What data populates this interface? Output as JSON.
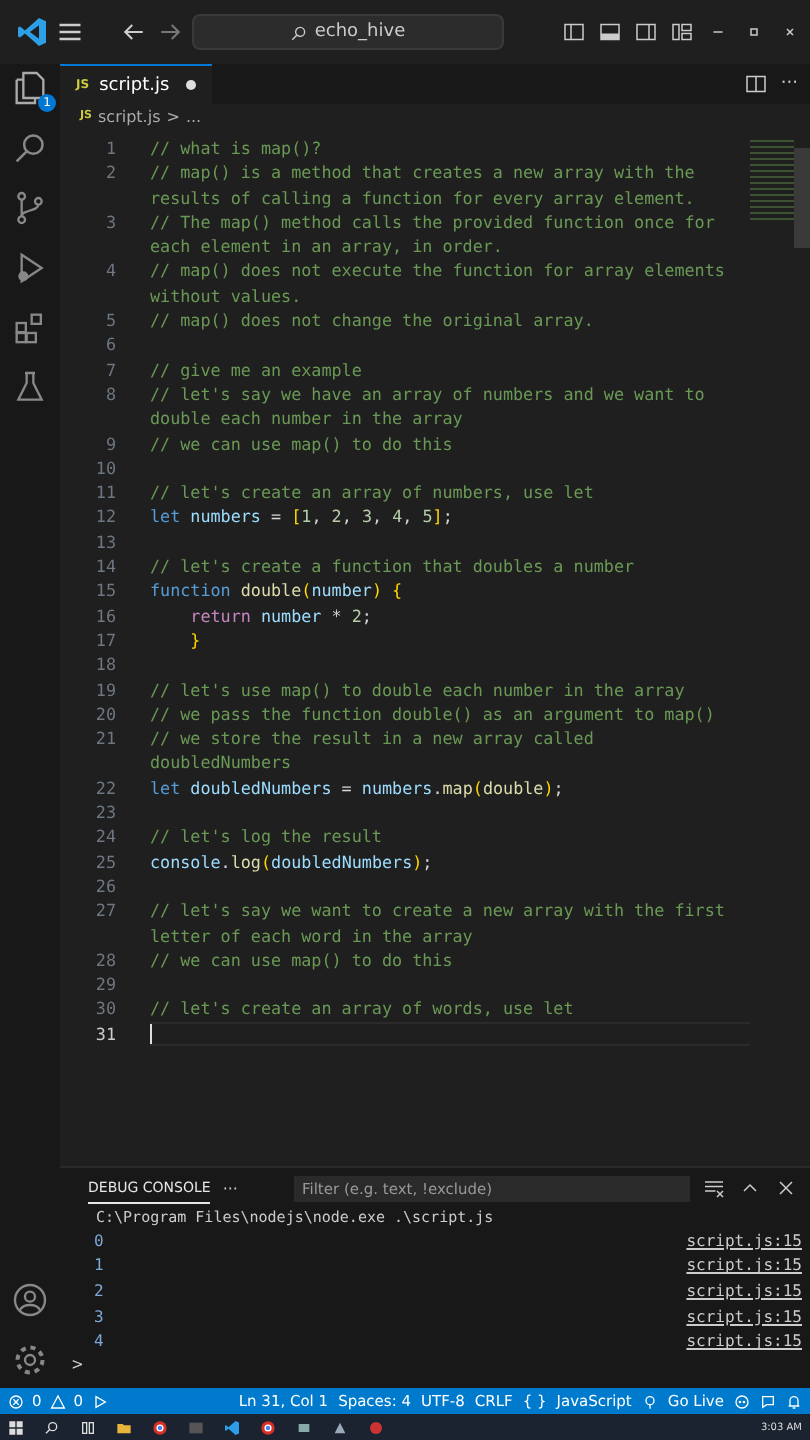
{
  "title_bar": {
    "search": "echo_hive"
  },
  "activity_bar": {
    "explorer_badge": "1"
  },
  "tabs": [
    {
      "label": "script.js",
      "file_icon": "JS",
      "modified": true,
      "selected": true
    }
  ],
  "editor_actions": {
    "more": "···"
  },
  "breadcrumb": {
    "file_icon": "JS",
    "file": "script.js",
    "separator": ">",
    "rest": "..."
  },
  "editor": {
    "lines": [
      {
        "number": "1",
        "current": false,
        "tokens": [
          {
            "kind": "comment",
            "text": "// what is map()?"
          }
        ]
      },
      {
        "number": "2",
        "current": false,
        "tokens": [
          {
            "kind": "comment",
            "text": "// map() is a method that creates a new array with the results of calling a function for every array element."
          }
        ]
      },
      {
        "number": "3",
        "current": false,
        "tokens": [
          {
            "kind": "comment",
            "text": "// The map() method calls the provided function once for each element in an array, in order."
          }
        ]
      },
      {
        "number": "4",
        "current": false,
        "tokens": [
          {
            "kind": "comment",
            "text": "// map() does not execute the function for array elements without values."
          }
        ]
      },
      {
        "number": "5",
        "current": false,
        "tokens": [
          {
            "kind": "comment",
            "text": "// map() does not change the original array."
          }
        ]
      },
      {
        "number": "6",
        "current": false
      },
      {
        "number": "7",
        "current": false,
        "tokens": [
          {
            "kind": "comment",
            "text": "// give me an example"
          }
        ]
      },
      {
        "number": "8",
        "current": false,
        "tokens": [
          {
            "kind": "comment",
            "text": "// let's say we have an array of numbers and we want to double each number in the array"
          }
        ]
      },
      {
        "number": "9",
        "current": false,
        "tokens": [
          {
            "kind": "comment",
            "text": "// we can use map() to do this"
          }
        ]
      },
      {
        "number": "10",
        "current": false
      },
      {
        "number": "11",
        "current": false,
        "tokens": [
          {
            "kind": "comment",
            "text": "// let's create an array of numbers, use let"
          }
        ]
      },
      {
        "number": "12",
        "current": false,
        "tokens": [
          {
            "kind": "keyword",
            "text": "let "
          },
          {
            "kind": "variable",
            "text": "numbers"
          },
          {
            "kind": "plain",
            "text": " = "
          },
          {
            "kind": "bracket",
            "text": "["
          },
          {
            "kind": "number",
            "text": "1"
          },
          {
            "kind": "plain",
            "text": ", "
          },
          {
            "kind": "number",
            "text": "2"
          },
          {
            "kind": "plain",
            "text": ", "
          },
          {
            "kind": "number",
            "text": "3"
          },
          {
            "kind": "plain",
            "text": ", "
          },
          {
            "kind": "number",
            "text": "4"
          },
          {
            "kind": "plain",
            "text": ", "
          },
          {
            "kind": "number",
            "text": "5"
          },
          {
            "kind": "bracket",
            "text": "]"
          },
          {
            "kind": "plain",
            "text": ";"
          }
        ]
      },
      {
        "number": "13",
        "current": false
      },
      {
        "number": "14",
        "current": false,
        "tokens": [
          {
            "kind": "comment",
            "text": "// let's create a function that doubles a number"
          }
        ]
      },
      {
        "number": "15",
        "current": false,
        "tokens": [
          {
            "kind": "keyword",
            "text": "function "
          },
          {
            "kind": "function",
            "text": "double"
          },
          {
            "kind": "bracket",
            "text": "("
          },
          {
            "kind": "variable",
            "text": "number"
          },
          {
            "kind": "bracket",
            "text": ") {"
          }
        ]
      },
      {
        "number": "16",
        "current": false,
        "tokens": [
          {
            "kind": "control",
            "text": "    return "
          },
          {
            "kind": "variable",
            "text": "number"
          },
          {
            "kind": "plain",
            "text": " * "
          },
          {
            "kind": "number",
            "text": "2"
          },
          {
            "kind": "plain",
            "text": ";"
          }
        ]
      },
      {
        "number": "17",
        "current": false,
        "tokens": [
          {
            "kind": "bracket",
            "text": "    }"
          }
        ]
      },
      {
        "number": "18",
        "current": false
      },
      {
        "number": "19",
        "current": false,
        "tokens": [
          {
            "kind": "comment",
            "text": "// let's use map() to double each number in the array"
          }
        ]
      },
      {
        "number": "20",
        "current": false,
        "tokens": [
          {
            "kind": "comment",
            "text": "// we pass the function double() as an argument to map()"
          }
        ]
      },
      {
        "number": "21",
        "current": false,
        "tokens": [
          {
            "kind": "comment",
            "text": "// we store the result in a new array called doubledNumbers"
          }
        ]
      },
      {
        "number": "22",
        "current": false,
        "tokens": [
          {
            "kind": "keyword",
            "text": "let "
          },
          {
            "kind": "variable",
            "text": "doubledNumbers"
          },
          {
            "kind": "plain",
            "text": " = "
          },
          {
            "kind": "variable",
            "text": "numbers"
          },
          {
            "kind": "plain",
            "text": "."
          },
          {
            "kind": "function",
            "text": "map"
          },
          {
            "kind": "bracket",
            "text": "("
          },
          {
            "kind": "function",
            "text": "double"
          },
          {
            "kind": "bracket",
            "text": ")"
          },
          {
            "kind": "plain",
            "text": ";"
          }
        ]
      },
      {
        "number": "23",
        "current": false
      },
      {
        "number": "24",
        "current": false,
        "tokens": [
          {
            "kind": "comment",
            "text": "// let's log the result"
          }
        ]
      },
      {
        "number": "25",
        "current": false,
        "tokens": [
          {
            "kind": "variable",
            "text": "console"
          },
          {
            "kind": "plain",
            "text": "."
          },
          {
            "kind": "function",
            "text": "log"
          },
          {
            "kind": "bracket",
            "text": "("
          },
          {
            "kind": "variable",
            "text": "doubledNumbers"
          },
          {
            "kind": "bracket",
            "text": ")"
          },
          {
            "kind": "plain",
            "text": ";"
          }
        ]
      },
      {
        "number": "26",
        "current": false
      },
      {
        "number": "27",
        "current": false,
        "tokens": [
          {
            "kind": "comment",
            "text": "// let's say we want to create a new array with the first letter of each word in the array"
          }
        ]
      },
      {
        "number": "28",
        "current": false,
        "tokens": [
          {
            "kind": "comment",
            "text": "// we can use map() to do this"
          }
        ]
      },
      {
        "number": "29",
        "current": false
      },
      {
        "number": "30",
        "current": false,
        "tokens": [
          {
            "kind": "comment",
            "text": "// let's create an array of words, use let"
          }
        ]
      },
      {
        "number": "31",
        "current": true
      }
    ]
  },
  "panel": {
    "tabs": [
      {
        "label": "DEBUG CONSOLE",
        "selected": true
      }
    ],
    "more": "···",
    "filter_placeholder": "Filter (e.g. text, !exclude)",
    "command": "C:\\Program Files\\nodejs\\node.exe .\\script.js",
    "output": [
      {
        "value": "0",
        "source": "script.js:15"
      },
      {
        "value": "1",
        "source": "script.js:15"
      },
      {
        "value": "2",
        "source": "script.js:15"
      },
      {
        "value": "3",
        "source": "script.js:15"
      },
      {
        "value": "4",
        "source": "script.js:15"
      }
    ],
    "prompt": ">"
  },
  "status_bar": {
    "errors": "0",
    "warnings": "0",
    "items": [
      "Ln 31, Col 1",
      "Spaces: 4",
      "UTF-8",
      "CRLF"
    ],
    "language": "JavaScript",
    "language_icon": "{ }",
    "go_live": "Go Live"
  },
  "taskbar": {
    "time": "3:03 AM"
  }
}
